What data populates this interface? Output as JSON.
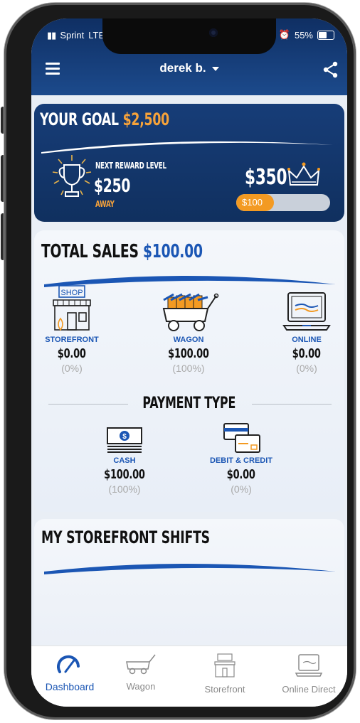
{
  "status_bar": {
    "carrier": "Sprint",
    "network": "LTE",
    "battery": "55%"
  },
  "header": {
    "user_name": "derek b."
  },
  "goal": {
    "title": "YOUR GOAL",
    "amount": "$2,500",
    "next_reward_label": "NEXT REWARD LEVEL",
    "next_reward_amount": "$250",
    "away_label": "AWAY",
    "reward_target": "$350",
    "progress_label": "$100",
    "progress_fraction": 0.4
  },
  "total_sales": {
    "title": "TOTAL SALES",
    "amount": "$100.00",
    "channels": [
      {
        "icon": "storefront-icon",
        "label": "STOREFRONT",
        "value": "$0.00",
        "pct": "(0%)"
      },
      {
        "icon": "wagon-icon",
        "label": "WAGON",
        "value": "$100.00",
        "pct": "(100%)"
      },
      {
        "icon": "laptop-icon",
        "label": "ONLINE",
        "value": "$0.00",
        "pct": "(0%)"
      }
    ],
    "payment_title": "PAYMENT TYPE",
    "payments": [
      {
        "icon": "cash-icon",
        "label": "CASH",
        "value": "$100.00",
        "pct": "(100%)"
      },
      {
        "icon": "credit-card-icon",
        "label": "DEBIT & CREDIT",
        "value": "$0.00",
        "pct": "(0%)"
      }
    ]
  },
  "shifts": {
    "title": "MY STOREFRONT SHIFTS"
  },
  "tabs": [
    {
      "label": "Dashboard",
      "icon": "dashboard-gauge-icon",
      "active": true
    },
    {
      "label": "Wagon",
      "icon": "wagon-icon",
      "active": false
    },
    {
      "label": "Storefront",
      "icon": "storefront-icon",
      "active": false
    },
    {
      "label": "Online Direct",
      "icon": "laptop-icon",
      "active": false
    }
  ],
  "colors": {
    "brand_blue": "#1b56b4",
    "header_navy": "#0f2f63",
    "accent_orange": "#f39a22"
  }
}
